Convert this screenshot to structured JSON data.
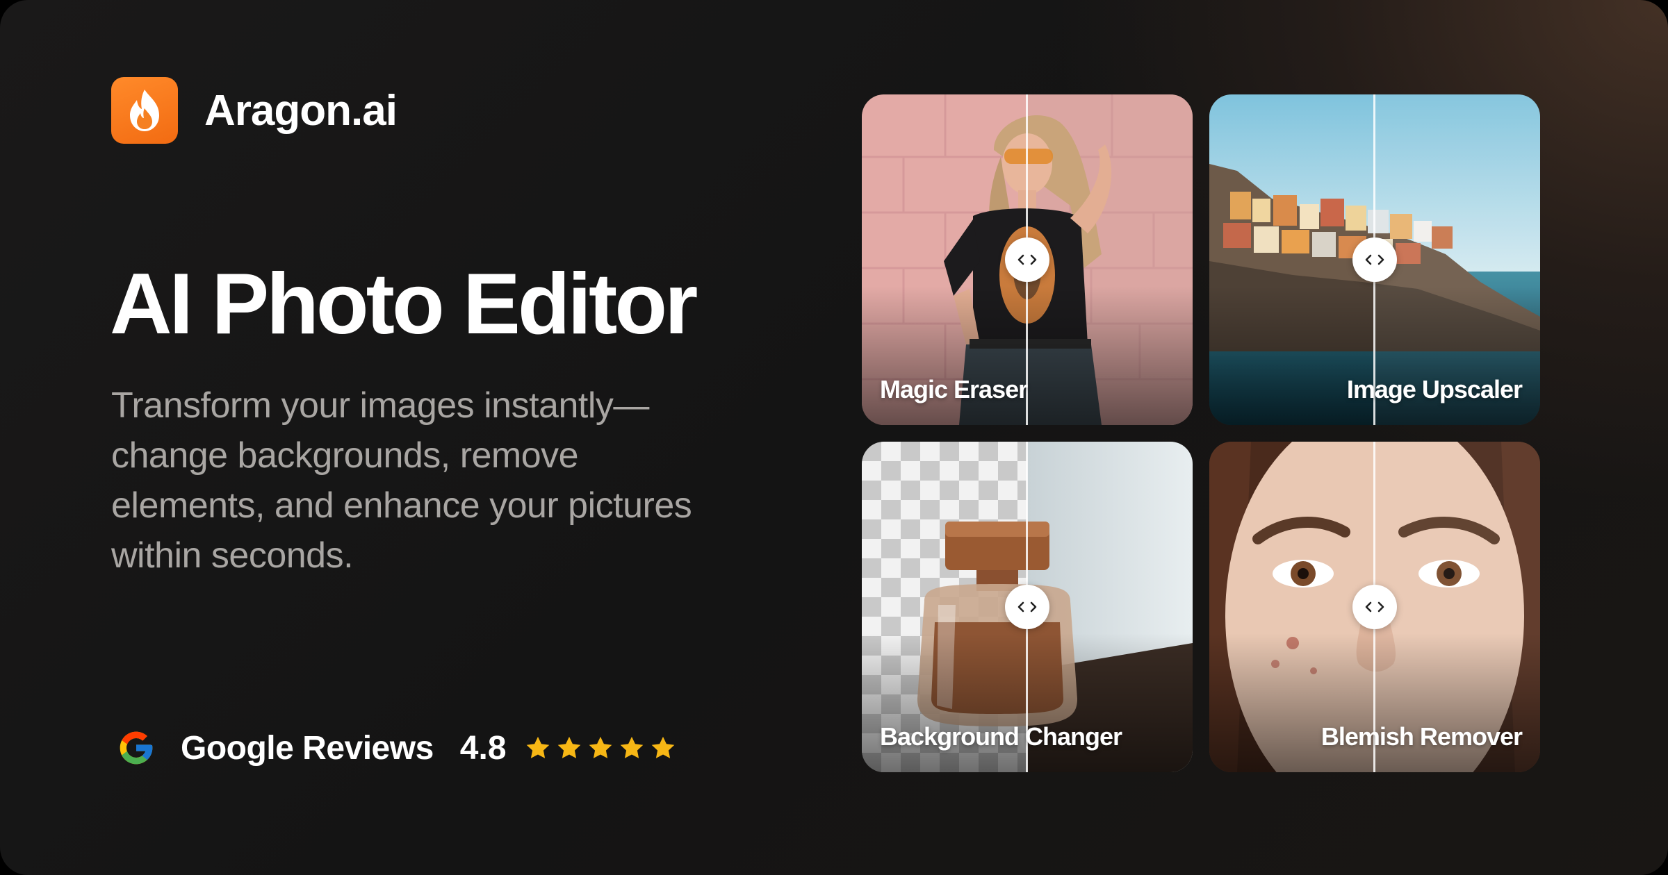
{
  "brand": {
    "name": "Aragon.ai",
    "logo_icon": "flame-icon",
    "accent": "#F37317"
  },
  "hero": {
    "title": "AI Photo Editor",
    "subtitle": "Transform your images instantly—change backgrounds, remove elements, and enhance your pictures within seconds."
  },
  "reviews": {
    "source": "Google Reviews",
    "source_icon": "google-icon",
    "rating": "4.8",
    "stars": 5,
    "star_color": "#F7B715"
  },
  "features": [
    {
      "label": "Magic Eraser",
      "icon": "compare-arrows-icon"
    },
    {
      "label": "Image Upscaler",
      "icon": "compare-arrows-icon"
    },
    {
      "label": "Background Changer",
      "icon": "compare-arrows-icon"
    },
    {
      "label": "Blemish Remover",
      "icon": "compare-arrows-icon"
    }
  ]
}
